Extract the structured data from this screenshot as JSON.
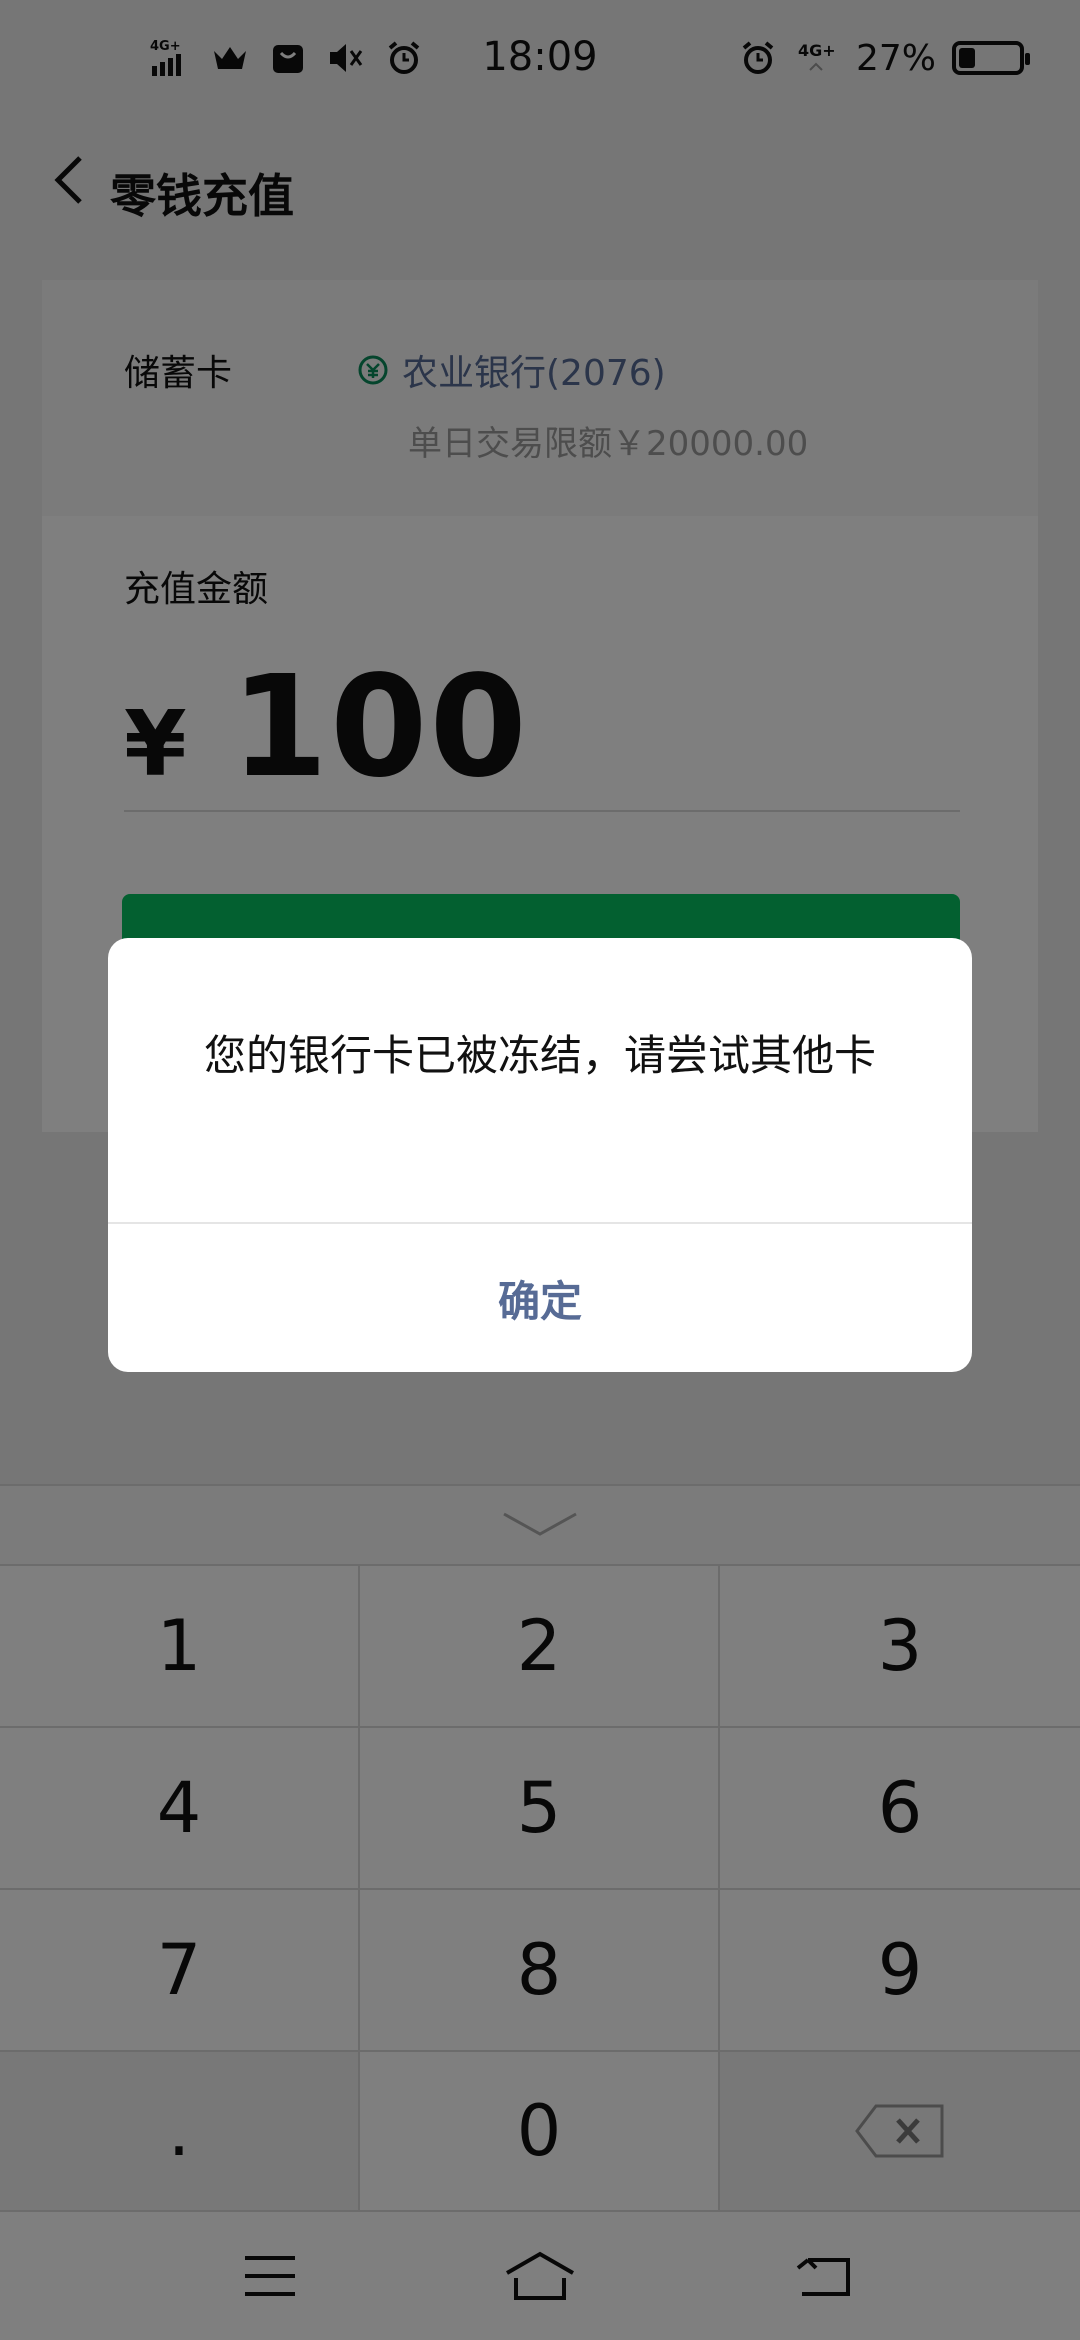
{
  "status_bar": {
    "time": "18:09",
    "battery_percent": "27%",
    "battery_level": 0.27,
    "left_icons": [
      "signal-4g-icon",
      "crown-icon",
      "bag-icon",
      "mute-icon",
      "alarm-icon"
    ],
    "right_icons": [
      "alarm-icon",
      "signal-4g-icon",
      "battery-icon"
    ],
    "network_label": "4G+"
  },
  "header": {
    "title": "零钱充值",
    "back_icon": "chevron-left-icon"
  },
  "card": {
    "label": "储蓄卡",
    "bank_name": "农业银行(2076)",
    "limit_text": "单日交易限额￥20000.00"
  },
  "amount": {
    "label": "充值金额",
    "currency": "¥",
    "value": "100"
  },
  "dialog": {
    "message": "您的银行卡已被冻结，请尝试其他卡",
    "confirm_label": "确定"
  },
  "keypad": {
    "keys": [
      "1",
      "2",
      "3",
      "4",
      "5",
      "6",
      "7",
      "8",
      "9",
      ".",
      "0",
      "delete"
    ],
    "collapse_icon": "chevron-down-icon",
    "delete_icon": "backspace-icon"
  },
  "nav_bar": {
    "icons": [
      "menu-icon",
      "home-icon",
      "back-icon"
    ]
  },
  "colors": {
    "accent_green": "#07c160",
    "link_blue": "#576b95",
    "overlay": "rgba(0,0,0,0.5)"
  }
}
